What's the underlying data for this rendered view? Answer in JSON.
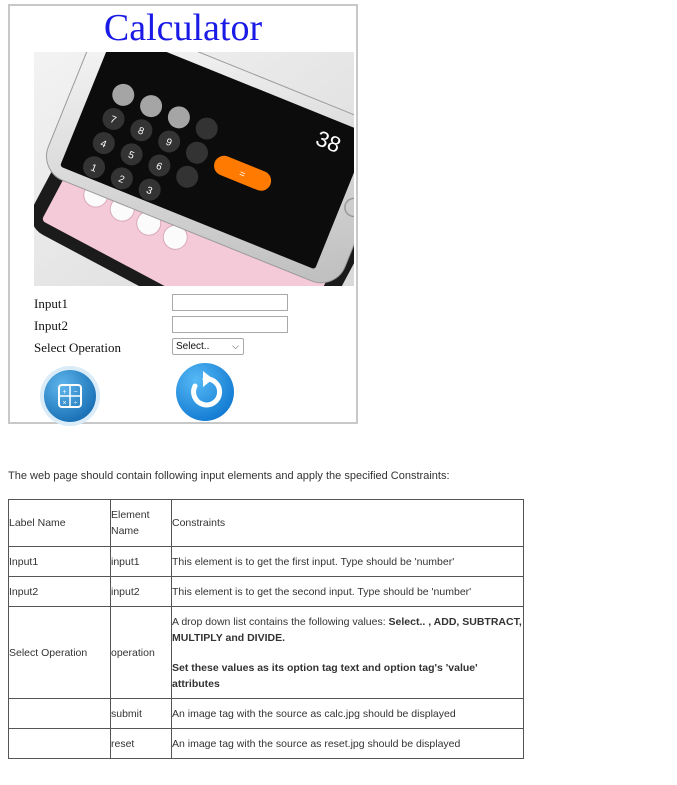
{
  "calculator": {
    "title": "Calculator",
    "hero_image": "calculator-phone-photo",
    "display_value": "38",
    "input1_label": "Input1",
    "input2_label": "Input2",
    "operation_label": "Select Operation",
    "input1_value": "",
    "input2_value": "",
    "operation_selected": "Select..",
    "submit_icon": "calculator-icon",
    "reset_icon": "reset-refresh-icon",
    "colors": {
      "title": "#1a1ae6",
      "submit_button": "#1c7fc6",
      "reset_button": "#1a8de0"
    }
  },
  "instructions": {
    "intro": "The web page should contain following input elements and apply the specified Constraints:"
  },
  "spec_table": {
    "headers": {
      "label": "Label Name",
      "element": "Element Name",
      "constraints": "Constraints"
    },
    "rows": [
      {
        "label": "Input1",
        "element": "input1",
        "constraint": "This element is to get the first input. Type should be 'number'"
      },
      {
        "label": "Input2",
        "element": "input2",
        "constraint": "This element is to get the second input. Type should be 'number'"
      },
      {
        "label": "Select Operation",
        "element": "operation",
        "constraint_prefix": "A drop down list contains the following values: ",
        "constraint_values": "Select.. , ADD, SUBTRACT, MULTIPLY and DIVIDE.",
        "constraint_note": "Set these values as its option tag text and option tag's 'value' attributes"
      },
      {
        "label": "",
        "element": "submit",
        "constraint": "An image tag with the source as calc.jpg should be displayed"
      },
      {
        "label": "",
        "element": "reset",
        "constraint": "An image tag with the source as reset.jpg should be displayed"
      }
    ]
  }
}
